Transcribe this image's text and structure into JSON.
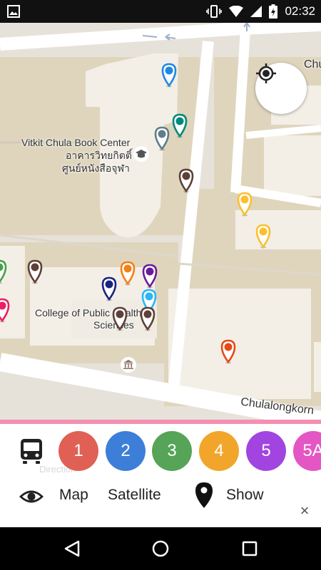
{
  "status_bar": {
    "time": "02:32",
    "icons": [
      "image-icon",
      "vibrate-icon",
      "wifi-icon",
      "signal-icon",
      "battery-charging-icon"
    ]
  },
  "map": {
    "labels": {
      "book_center_en": "Vitkit Chula Book Center",
      "book_center_th1": "อาคารวิทยกิตติ์",
      "book_center_th2": "ศูนย์หนังสือจุฬา",
      "college_line1": "College of Public Health",
      "college_line2": "Sciences",
      "road": "Chulalongkorn",
      "top_right": "Chu"
    },
    "pin_colors": {
      "blue": "#1e88e5",
      "teal": "#00897b",
      "grey": "#607d8b",
      "brown": "#5d4037",
      "yellow": "#fbc02d",
      "orange": "#f57f17",
      "purple": "#6a1b9a",
      "navy": "#1a237e",
      "lightblue": "#29b6f6",
      "green": "#43a047",
      "pink": "#e91e63",
      "red": "#e64a19"
    }
  },
  "lines": [
    {
      "label": "1",
      "color": "#e06055"
    },
    {
      "label": "2",
      "color": "#3d7fd8"
    },
    {
      "label": "3",
      "color": "#56a457"
    },
    {
      "label": "4",
      "color": "#f2a52b"
    },
    {
      "label": "5",
      "color": "#a245e0"
    },
    {
      "label": "5A",
      "color": "#e456c3"
    }
  ],
  "options": {
    "map": "Map",
    "satellite": "Satellite",
    "show": "Show"
  },
  "ghost_text": "Direction"
}
